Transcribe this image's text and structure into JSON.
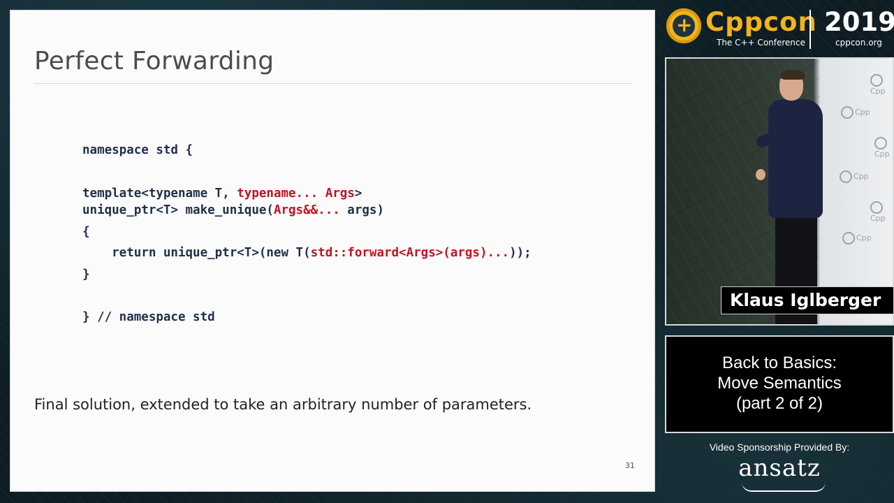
{
  "slide": {
    "title": "Perfect Forwarding",
    "code_lines": [
      [
        {
          "t": "namespace std {",
          "red": false
        }
      ],
      [
        {
          "t": "template<typename T, ",
          "red": false
        },
        {
          "t": "typename... Args",
          "red": true
        },
        {
          "t": ">",
          "red": false
        }
      ],
      [
        {
          "t": "unique_ptr<T> make_unique(",
          "red": false
        },
        {
          "t": "Args&&...",
          "red": true
        },
        {
          "t": " args)",
          "red": false
        }
      ],
      [
        {
          "t": "{",
          "red": false
        }
      ],
      [
        {
          "t": "    return unique_ptr<T>(new T(",
          "red": false
        },
        {
          "t": "std::forward<Args>(args)...",
          "red": true
        },
        {
          "t": "));",
          "red": false
        }
      ],
      [
        {
          "t": "}",
          "red": false
        }
      ],
      [
        {
          "t": "} // namespace std",
          "red": false
        }
      ]
    ],
    "caption": "Final solution, extended to take an arbitrary number of parameters.",
    "page_number": "31"
  },
  "branding": {
    "logo_name": "Cppcon",
    "logo_subtitle": "The C++ Conference",
    "year": "2019",
    "website": "cppcon.org",
    "accent_color": "#f2b31b"
  },
  "speaker": {
    "name": "Klaus Iglberger",
    "wall_logo_text": "Cpp"
  },
  "talk": {
    "title_lines": [
      "Back to Basics:",
      "Move Semantics",
      "(part 2 of 2)"
    ]
  },
  "sponsor": {
    "label": "Video Sponsorship Provided By:",
    "name": "ansatz"
  }
}
